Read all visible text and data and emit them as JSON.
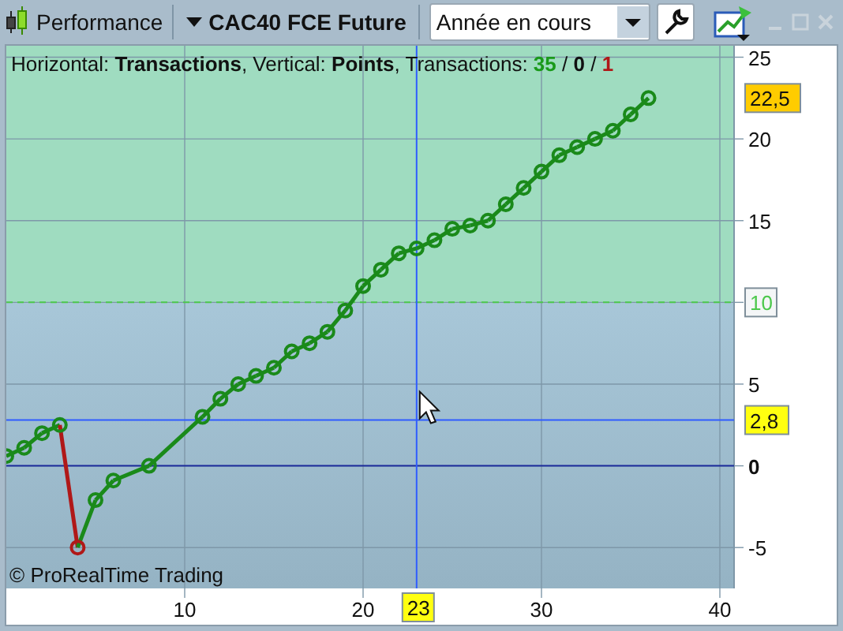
{
  "toolbar": {
    "title": "Performance",
    "instrument": "CAC40 FCE Future",
    "period": {
      "value": "Année en cours"
    }
  },
  "window_controls": [
    {
      "kind": "minimize",
      "disabled": true
    },
    {
      "kind": "maximize",
      "disabled": true
    },
    {
      "kind": "close",
      "disabled": true
    }
  ],
  "legend": [
    {
      "text": "Horizontal: ",
      "kind": "plain"
    },
    {
      "text": "Transactions",
      "kind": "bold"
    },
    {
      "text": ", Vertical: ",
      "kind": "plain"
    },
    {
      "text": "Points",
      "kind": "bold"
    },
    {
      "text": ", Transactions: ",
      "kind": "plain"
    },
    {
      "text": "35",
      "kind": "win"
    },
    {
      "text": " / ",
      "kind": "plain"
    },
    {
      "text": "0",
      "kind": "bold"
    },
    {
      "text": " / ",
      "kind": "plain"
    },
    {
      "text": "1",
      "kind": "loss"
    }
  ],
  "copyright": "© ProRealTime Trading",
  "chart_data": {
    "type": "line",
    "x": [
      0,
      1,
      2,
      3,
      4,
      5,
      6,
      8,
      11,
      12,
      13,
      14,
      15,
      16,
      17,
      18,
      19,
      20,
      21,
      22,
      23,
      24,
      25,
      26,
      27,
      28,
      29,
      30,
      31,
      32,
      33,
      34,
      35,
      36
    ],
    "series": [
      {
        "color": "#1a8a1a",
        "marker": "o",
        "values": [
          0.6,
          1.1,
          2,
          2.5,
          -5,
          -2.1,
          -0.9,
          0,
          3,
          4.1,
          5,
          5.5,
          6,
          7,
          7.5,
          8.2,
          9.5,
          11,
          12,
          13,
          13.3,
          13.8,
          14.5,
          14.7,
          15,
          16,
          17,
          18,
          19,
          19.5,
          20,
          20.5,
          21.5,
          22.5
        ]
      }
    ],
    "xlim": [
      0,
      40
    ],
    "ylim": [
      -7.5,
      25.7
    ],
    "xticks": [
      10,
      20,
      30,
      40
    ],
    "yticks": [
      -5,
      0,
      5,
      10,
      15,
      20,
      25
    ],
    "grid": true,
    "ref_lines": [
      {
        "axis": "y",
        "value": 0
      },
      {
        "axis": "y",
        "value": 10,
        "label": "10",
        "color": "#4cc84c"
      },
      {
        "axis": "y",
        "value": 2.8,
        "label": "2,8",
        "color": "#2f5cff"
      },
      {
        "axis": "x",
        "value": 23,
        "label": "23",
        "color": "#2f5cff"
      }
    ],
    "bands": [
      {
        "axis": "y",
        "from": 10,
        "to": 25.7,
        "color": "#9fdcc0"
      }
    ],
    "annotations": [
      "22,5"
    ]
  }
}
